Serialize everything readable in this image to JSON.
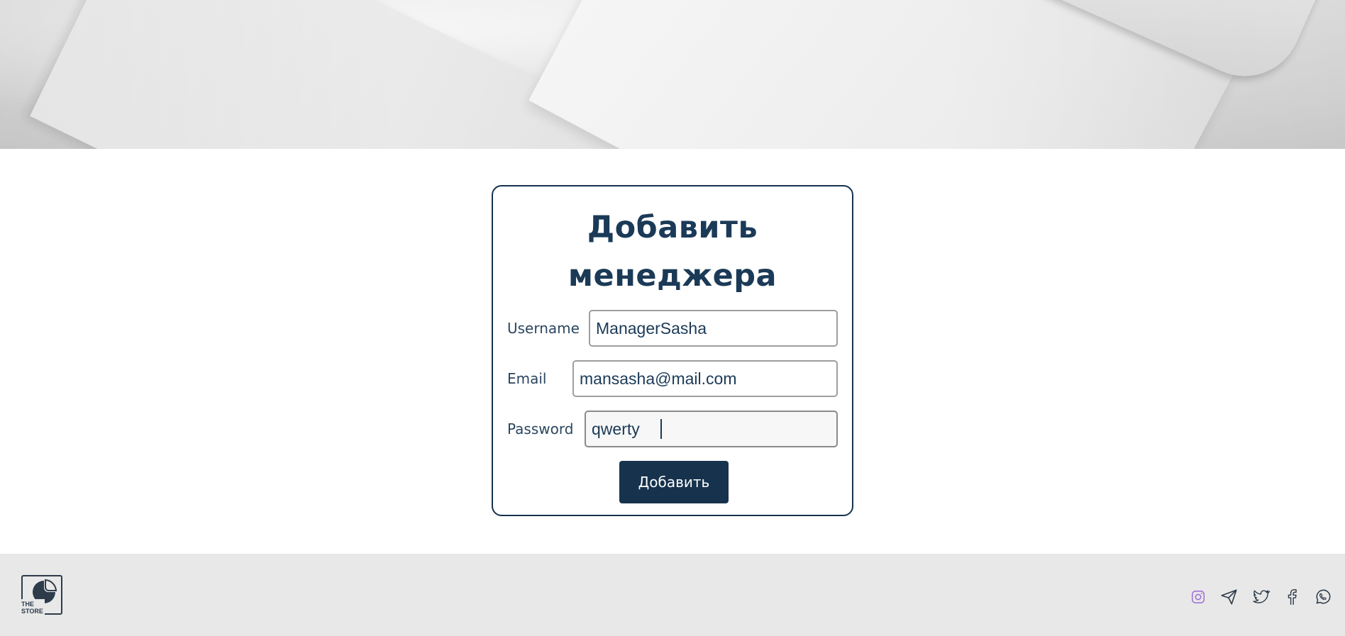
{
  "form": {
    "title_line1": "Добавить",
    "title_line2": "менеджера",
    "username_label": "Username",
    "username_value": "ManagerSasha",
    "email_label": "Email",
    "email_value": "mansasha@mail.com",
    "password_label": "Password",
    "password_value": "qwerty",
    "submit_label": "Добавить"
  },
  "footer": {
    "logo_text": "THE\nSTORE",
    "social_icons": [
      "instagram-icon",
      "telegram-icon",
      "twitter-icon",
      "facebook-icon",
      "whatsapp-icon"
    ]
  },
  "colors": {
    "primary": "#16324d",
    "footer_bg": "#e8e8e8",
    "instagram_accent": "#9b6bd6"
  }
}
